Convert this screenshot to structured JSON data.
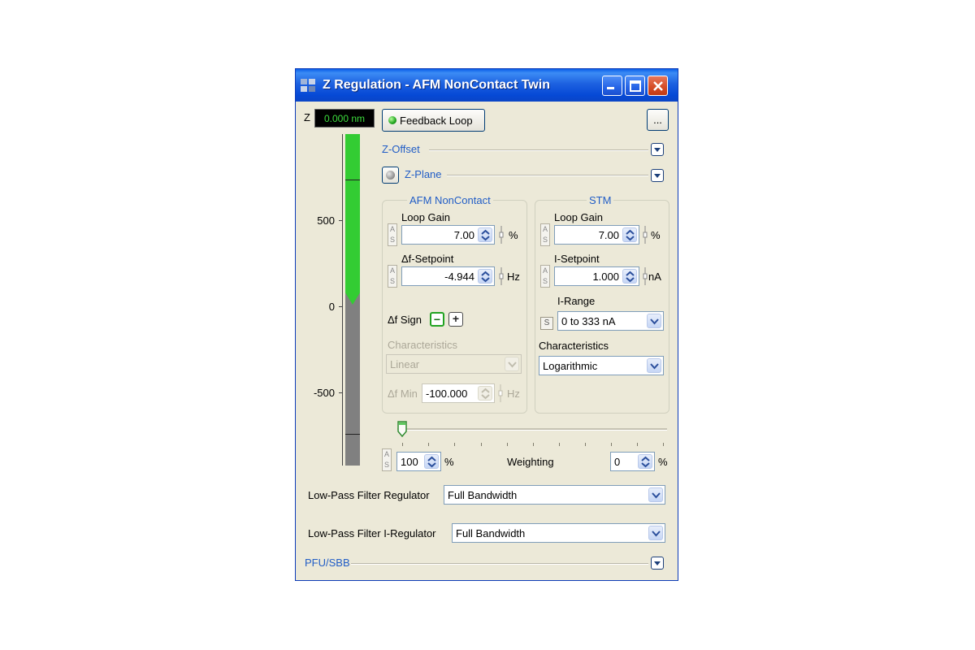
{
  "window": {
    "title": "Z Regulation - AFM NonContact Twin"
  },
  "z_meter": {
    "label": "Z",
    "readout": "0.000 nm",
    "scale_labels": [
      "500",
      "0",
      "-500"
    ]
  },
  "toolbar": {
    "feedback_label": "Feedback Loop",
    "more_label": "..."
  },
  "sections": {
    "z_offset": "Z-Offset",
    "z_plane": "Z-Plane",
    "pfu_sbb": "PFU/SBB"
  },
  "afm": {
    "title": "AFM NonContact",
    "loop_gain": {
      "label": "Loop Gain",
      "value": "7.00",
      "unit": "%"
    },
    "setpoint": {
      "label": "Δf-Setpoint",
      "value": "-4.944",
      "unit": "Hz"
    },
    "sign": {
      "label": "Δf Sign",
      "minus": "−",
      "plus": "+"
    },
    "characteristics": {
      "label": "Characteristics",
      "value": "Linear"
    },
    "fmin": {
      "label": "Δf Min",
      "value": "-100.000",
      "unit": "Hz"
    }
  },
  "stm": {
    "title": "STM",
    "loop_gain": {
      "label": "Loop Gain",
      "value": "7.00",
      "unit": "%"
    },
    "setpoint": {
      "label": "I-Setpoint",
      "value": "1.000",
      "unit": "nA"
    },
    "range": {
      "label": "I-Range",
      "value": "0 to 333 nA"
    },
    "characteristics": {
      "label": "Characteristics",
      "value": "Logarithmic"
    }
  },
  "weighting": {
    "label": "Weighting",
    "left_value": "100",
    "left_unit": "%",
    "right_value": "0",
    "right_unit": "%",
    "slider_fraction": 0.0
  },
  "filters": {
    "regulator_label": "Low-Pass Filter Regulator",
    "regulator_value": "Full Bandwidth",
    "iregulator_label": "Low-Pass Filter I-Regulator",
    "iregulator_value": "Full Bandwidth"
  },
  "as_labels": {
    "a": "A",
    "s": "S"
  }
}
